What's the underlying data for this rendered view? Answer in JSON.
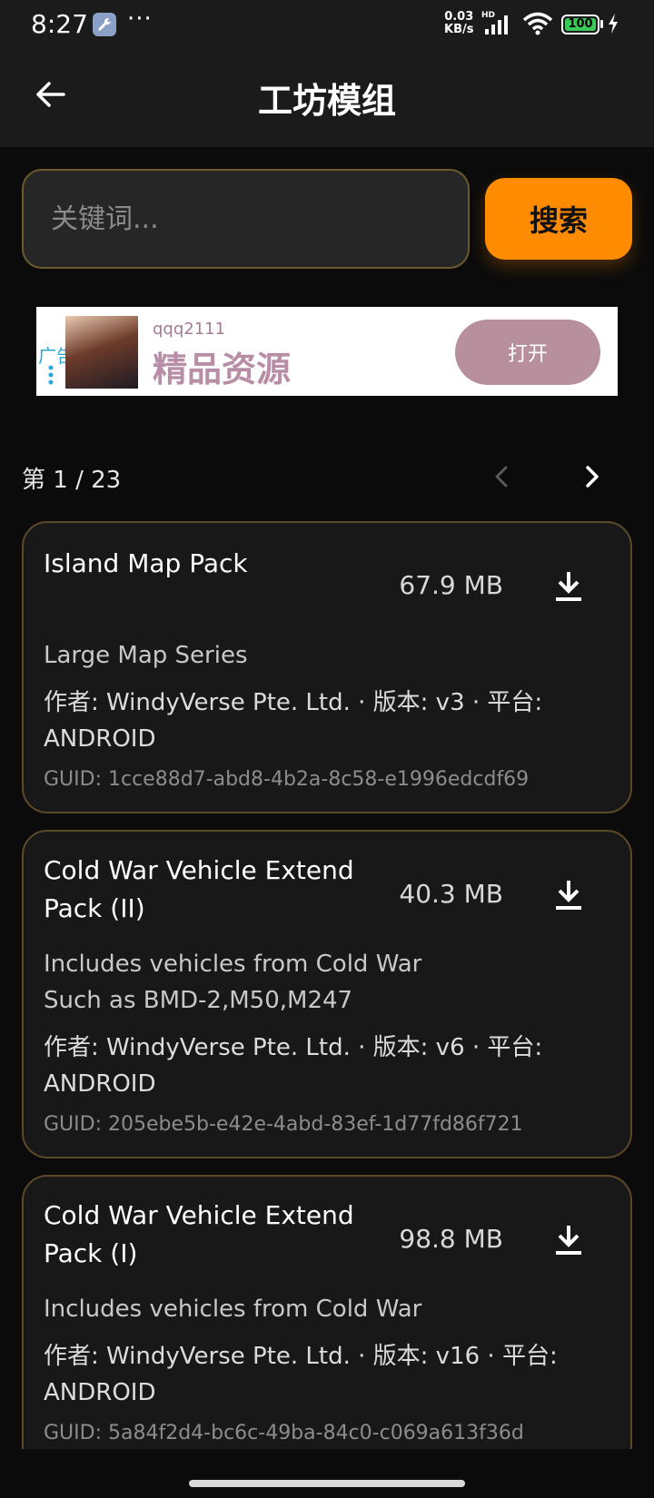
{
  "status_bar": {
    "time": "8:27",
    "dots": "···",
    "speed_value": "0.03",
    "speed_unit": "KB/s",
    "hd": "HD",
    "battery": "100"
  },
  "app_bar": {
    "title": "工坊模组"
  },
  "search": {
    "placeholder": "关键词...",
    "button_label": "搜索"
  },
  "ad": {
    "tag": "广告",
    "subtitle": "qqq2111",
    "headline": "精品资源",
    "open_label": "打开"
  },
  "pagination": {
    "label": "第 1 / 23"
  },
  "mods": [
    {
      "title": "Island Map Pack",
      "size": "67.9 MB",
      "description": "Large Map Series",
      "meta": "作者: WindyVerse Pte. Ltd.  ·  版本: v3  ·  平台: ANDROID",
      "guid": "GUID: 1cce88d7-abd8-4b2a-8c58-e1996edcdf69"
    },
    {
      "title": "Cold War Vehicle Extend Pack (II)",
      "size": "40.3 MB",
      "description": "Includes vehicles from Cold War\nSuch as BMD-2,M50,M247",
      "meta": "作者: WindyVerse Pte. Ltd.  ·  版本: v6  ·  平台: ANDROID",
      "guid": "GUID: 205ebe5b-e42e-4abd-83ef-1d77fd86f721"
    },
    {
      "title": "Cold War Vehicle Extend Pack (I)",
      "size": "98.8 MB",
      "description": "Includes vehicles from Cold War",
      "meta": "作者: WindyVerse Pte. Ltd.  ·  版本: v16  ·  平台: ANDROID",
      "guid": "GUID: 5a84f2d4-bc6c-49ba-84c0-c069a613f36d"
    }
  ],
  "colors": {
    "accent": "#ff8c00",
    "card_border": "#5c4927",
    "background": "#0b0b0b"
  },
  "icons": {
    "back": "arrow-left-icon",
    "prev": "chevron-left-icon",
    "next": "chevron-right-icon",
    "download": "download-icon"
  }
}
